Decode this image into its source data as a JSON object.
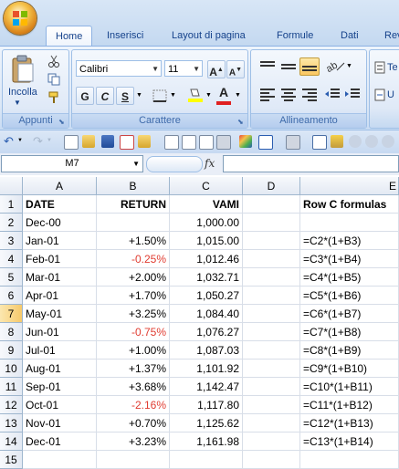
{
  "ribbon": {
    "tabs": [
      "Home",
      "Inserisci",
      "Layout di pagina",
      "Formule",
      "Dati",
      "Rev"
    ],
    "active_tab": "Home",
    "clipboard": {
      "paste_label": "Incolla",
      "group_label": "Appunti"
    },
    "font": {
      "name": "Calibri",
      "size": "11",
      "bold": "G",
      "italic": "C",
      "underline": "S",
      "group_label": "Carattere"
    },
    "alignment": {
      "group_label": "Allineamento",
      "wrap_label": "Te",
      "merge_label": "U"
    }
  },
  "formula_bar": {
    "name_box": "M7",
    "fx_label": "fx",
    "formula": ""
  },
  "sheet": {
    "columns": [
      "A",
      "B",
      "C",
      "D",
      "E"
    ],
    "rows": [
      {
        "num": "1",
        "a": "DATE",
        "b": "RETURN",
        "c": "VAMI",
        "e": "Row C formulas",
        "header": true
      },
      {
        "num": "2",
        "a": "Dec-00",
        "b": "",
        "c": "1,000.00",
        "e": ""
      },
      {
        "num": "3",
        "a": "Jan-01",
        "b": "+1.50%",
        "c": "1,015.00",
        "e": "=C2*(1+B3)"
      },
      {
        "num": "4",
        "a": "Feb-01",
        "b": "-0.25%",
        "c": "1,012.46",
        "e": "=C3*(1+B4)",
        "neg": true
      },
      {
        "num": "5",
        "a": "Mar-01",
        "b": "+2.00%",
        "c": "1,032.71",
        "e": "=C4*(1+B5)"
      },
      {
        "num": "6",
        "a": "Apr-01",
        "b": "+1.70%",
        "c": "1,050.27",
        "e": "=C5*(1+B6)"
      },
      {
        "num": "7",
        "a": "May-01",
        "b": "+3.25%",
        "c": "1,084.40",
        "e": "=C6*(1+B7)"
      },
      {
        "num": "8",
        "a": "Jun-01",
        "b": "-0.75%",
        "c": "1,076.27",
        "e": "=C7*(1+B8)",
        "neg": true
      },
      {
        "num": "9",
        "a": "Jul-01",
        "b": "+1.00%",
        "c": "1,087.03",
        "e": "=C8*(1+B9)"
      },
      {
        "num": "10",
        "a": "Aug-01",
        "b": "+1.37%",
        "c": "1,101.92",
        "e": "=C9*(1+B10)"
      },
      {
        "num": "11",
        "a": "Sep-01",
        "b": "+3.68%",
        "c": "1,142.47",
        "e": "=C10*(1+B11)"
      },
      {
        "num": "12",
        "a": "Oct-01",
        "b": "-2.16%",
        "c": "1,117.80",
        "e": "=C11*(1+B12)",
        "neg": true
      },
      {
        "num": "13",
        "a": "Nov-01",
        "b": "+0.70%",
        "c": "1,125.62",
        "e": "=C12*(1+B13)"
      },
      {
        "num": "14",
        "a": "Dec-01",
        "b": "+3.23%",
        "c": "1,161.98",
        "e": "=C13*(1+B14)"
      },
      {
        "num": "15",
        "a": "",
        "b": "",
        "c": "",
        "e": ""
      }
    ],
    "selected_row": "7",
    "colors": {
      "negative": "#e03c31",
      "selection": "#f6c96a",
      "ribbon": "#dce8f7"
    }
  }
}
